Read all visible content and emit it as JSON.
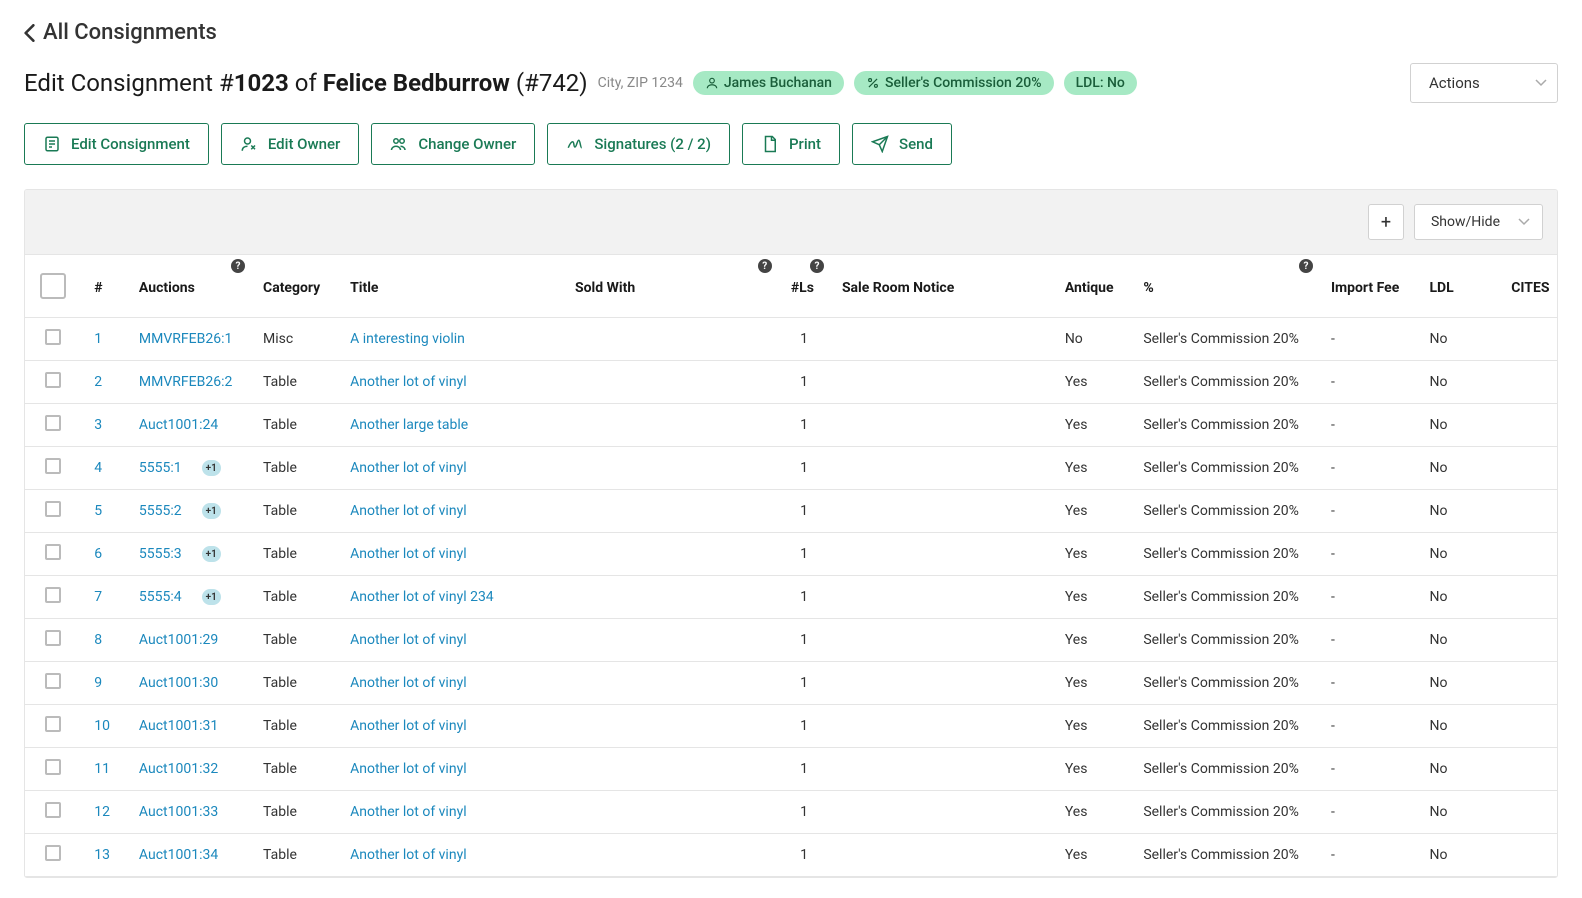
{
  "breadcrumb": {
    "label": "All Consignments"
  },
  "page_title": {
    "prefix": "Edit Consignment #",
    "consignment_no": "1023",
    "of": " of ",
    "owner_name": "Felice Bedburrow",
    "owner_no_prefix": " (#",
    "owner_no": "742",
    "owner_no_suffix": ")"
  },
  "location": "City, ZIP 1234",
  "badges": {
    "agent": "James Buchanan",
    "commission": "Seller's Commission 20%",
    "ldl": "LDL: No"
  },
  "actions_dropdown": "Actions",
  "toolbar": {
    "edit_consignment": "Edit Consignment",
    "edit_owner": "Edit Owner",
    "change_owner": "Change Owner",
    "signatures": "Signatures (2 / 2)",
    "print": "Print",
    "send": "Send"
  },
  "table_toolbar": {
    "showhide": "Show/Hide"
  },
  "columns": {
    "num": "#",
    "auctions": "Auctions",
    "category": "Category",
    "title": "Title",
    "sold_with": "Sold With",
    "ls": "#Ls",
    "srn": "Sale Room Notice",
    "antique": "Antique",
    "pct": "%",
    "import_fee": "Import Fee",
    "ldl": "LDL",
    "cites": "CITES"
  },
  "rows": [
    {
      "num": "1",
      "auction": "MMVRFEB26:1",
      "plus": "",
      "category": "Misc",
      "title": "A interesting violin",
      "ls": "1",
      "antique": "No",
      "pct": "Seller's Commission 20%",
      "import": "-",
      "ldl": "No"
    },
    {
      "num": "2",
      "auction": "MMVRFEB26:2",
      "plus": "",
      "category": "Table",
      "title": "Another lot of vinyl",
      "ls": "1",
      "antique": "Yes",
      "pct": "Seller's Commission 20%",
      "import": "-",
      "ldl": "No"
    },
    {
      "num": "3",
      "auction": "Auct1001:24",
      "plus": "",
      "category": "Table",
      "title": "Another large table",
      "ls": "1",
      "antique": "Yes",
      "pct": "Seller's Commission 20%",
      "import": "-",
      "ldl": "No"
    },
    {
      "num": "4",
      "auction": "5555:1",
      "plus": "+1",
      "category": "Table",
      "title": "Another lot of vinyl",
      "ls": "1",
      "antique": "Yes",
      "pct": "Seller's Commission 20%",
      "import": "-",
      "ldl": "No"
    },
    {
      "num": "5",
      "auction": "5555:2",
      "plus": "+1",
      "category": "Table",
      "title": "Another lot of vinyl",
      "ls": "1",
      "antique": "Yes",
      "pct": "Seller's Commission 20%",
      "import": "-",
      "ldl": "No"
    },
    {
      "num": "6",
      "auction": "5555:3",
      "plus": "+1",
      "category": "Table",
      "title": "Another lot of vinyl",
      "ls": "1",
      "antique": "Yes",
      "pct": "Seller's Commission 20%",
      "import": "-",
      "ldl": "No"
    },
    {
      "num": "7",
      "auction": "5555:4",
      "plus": "+1",
      "category": "Table",
      "title": "Another lot of vinyl 234",
      "ls": "1",
      "antique": "Yes",
      "pct": "Seller's Commission 20%",
      "import": "-",
      "ldl": "No"
    },
    {
      "num": "8",
      "auction": "Auct1001:29",
      "plus": "",
      "category": "Table",
      "title": "Another lot of vinyl",
      "ls": "1",
      "antique": "Yes",
      "pct": "Seller's Commission 20%",
      "import": "-",
      "ldl": "No"
    },
    {
      "num": "9",
      "auction": "Auct1001:30",
      "plus": "",
      "category": "Table",
      "title": "Another lot of vinyl",
      "ls": "1",
      "antique": "Yes",
      "pct": "Seller's Commission 20%",
      "import": "-",
      "ldl": "No"
    },
    {
      "num": "10",
      "auction": "Auct1001:31",
      "plus": "",
      "category": "Table",
      "title": "Another lot of vinyl",
      "ls": "1",
      "antique": "Yes",
      "pct": "Seller's Commission 20%",
      "import": "-",
      "ldl": "No"
    },
    {
      "num": "11",
      "auction": "Auct1001:32",
      "plus": "",
      "category": "Table",
      "title": "Another lot of vinyl",
      "ls": "1",
      "antique": "Yes",
      "pct": "Seller's Commission 20%",
      "import": "-",
      "ldl": "No"
    },
    {
      "num": "12",
      "auction": "Auct1001:33",
      "plus": "",
      "category": "Table",
      "title": "Another lot of vinyl",
      "ls": "1",
      "antique": "Yes",
      "pct": "Seller's Commission 20%",
      "import": "-",
      "ldl": "No"
    },
    {
      "num": "13",
      "auction": "Auct1001:34",
      "plus": "",
      "category": "Table",
      "title": "Another lot of vinyl",
      "ls": "1",
      "antique": "Yes",
      "pct": "Seller's Commission 20%",
      "import": "-",
      "ldl": "No"
    }
  ]
}
